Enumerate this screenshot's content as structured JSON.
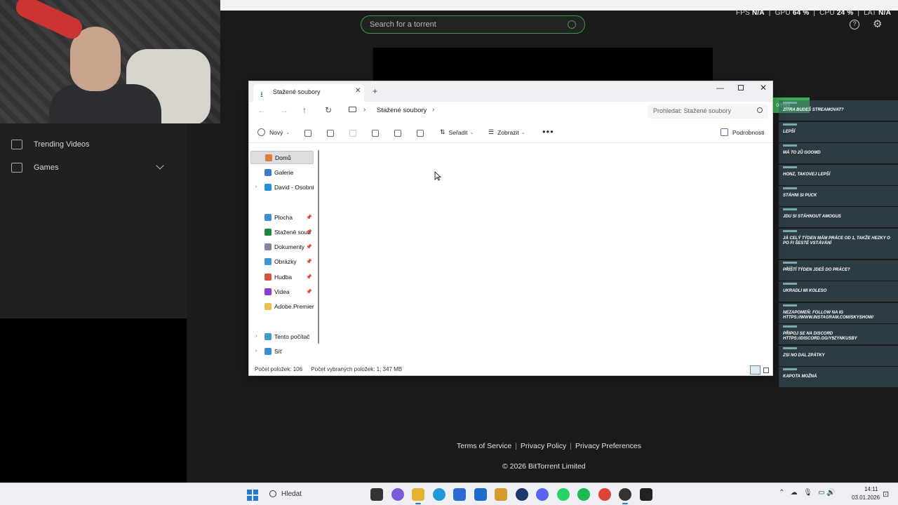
{
  "bittorrent": {
    "search_placeholder": "Search for a torrent",
    "stats": {
      "fps_label": "FPS",
      "fps_value": "N/A",
      "gpu_label": "GPU",
      "gpu_value": "64 %",
      "cpu_label": "CPU",
      "cpu_value": "24 %",
      "lat_label": "LAT",
      "lat_value": "N/A"
    },
    "sidebar": {
      "items": [
        {
          "label": "Trending Videos",
          "icon": "trending-icon"
        },
        {
          "label": "Games",
          "icon": "games-icon"
        }
      ]
    },
    "footer": {
      "links": [
        "Terms of Service",
        "Privacy Policy",
        "Privacy Preferences"
      ],
      "copyright": "© 2026 BitTorrent Limited"
    },
    "accent_color": "#3e9b4a"
  },
  "explorer": {
    "tab_title": "Stažené soubory",
    "breadcrumb": "Stažené soubory",
    "search_placeholder": "Prohledat: Stažené soubory",
    "toolbar": {
      "new_label": "Nový",
      "sort_label": "Seřadit",
      "view_label": "Zobrazit",
      "details_label": "Podrobnosti"
    },
    "nav": [
      {
        "label": "Domů",
        "icon": "home-icon",
        "selected": true
      },
      {
        "label": "Galerie",
        "icon": "gallery-icon"
      },
      {
        "label": "David - Osobní",
        "icon": "onedrive-icon",
        "expandable": true
      },
      {
        "label": "Plocha",
        "icon": "desktop-icon",
        "pinned": true
      },
      {
        "label": "Stažené soub",
        "icon": "downloads-icon",
        "pinned": true
      },
      {
        "label": "Dokumenty",
        "icon": "documents-icon",
        "pinned": true
      },
      {
        "label": "Obrázky",
        "icon": "pictures-icon",
        "pinned": true
      },
      {
        "label": "Hudba",
        "icon": "music-icon",
        "pinned": true
      },
      {
        "label": "Videa",
        "icon": "videos-icon",
        "pinned": true
      },
      {
        "label": "Adobe.Premiere",
        "icon": "folder-icon"
      },
      {
        "label": "Tento počítač",
        "icon": "this-pc-icon",
        "expandable": true
      },
      {
        "label": "Síť",
        "icon": "network-icon",
        "expandable": true
      }
    ],
    "status": {
      "items_count": "Počet položek: 106",
      "selected": "Počet vybraných položek: 1; 347 MB"
    }
  },
  "chat": {
    "badge": "orrent",
    "messages": [
      "ZÍTRA BUDEŠ STREAMOVAT?",
      "LEPŠÍ",
      "MÁ TO 2Ů GOOMD",
      "HONZ, TAKOVEJ LEPŠÍ",
      "STÁHNI SI PUCK",
      "JDU SI STÁHNOUT AMOGUS",
      "JÁ CELÝ TÝDEN MÁM PRÁCE OD 1, TAKŽE HEZKY O PO FI ŠESTÉ VSTÁVÁNÍ",
      "PŘÍŠTÍ TÝDEN JDEŠ DO PRÁCE?",
      "UKRADLI MI KOLESO",
      "NEZAPOMEŇ: FOLLOW NA IG HTTPS://WWW.INSTAGRAM.COM/SKYSHOW/",
      "PŘIPOJ SE NA DISCORD HTTPS://DISCORD.GG/Y9ZYNKUSBY",
      "ZSI NO DAL ZPÁTKY",
      "KAPOTA MOŽNÁ"
    ]
  },
  "taskbar": {
    "search_label": "Hledat",
    "time": "14:11",
    "date": "03.01.2026",
    "apps": [
      "file-explorer-icon",
      "copilot-icon",
      "folder-icon",
      "edge-icon",
      "store-icon",
      "outlook-icon",
      "winamp-icon",
      "steam-icon",
      "discord-icon",
      "whatsapp-icon",
      "spotify-icon",
      "chrome-icon",
      "obs-icon",
      "epic-games-icon"
    ]
  }
}
